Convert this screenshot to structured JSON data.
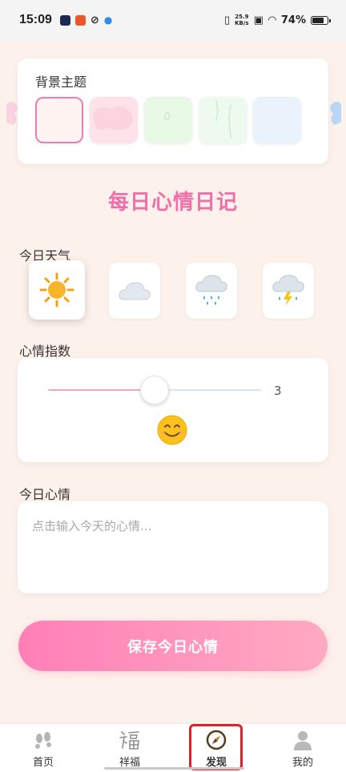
{
  "status_bar": {
    "time": "15:09",
    "net_speed_value": "25.9",
    "net_speed_unit": "KB/s",
    "battery": "74%"
  },
  "theme": {
    "title": "背景主题",
    "swatches": [
      {
        "name": "plain-peach",
        "color": "#fff4f1"
      },
      {
        "name": "pink-cloud",
        "color": "#fde3e9"
      },
      {
        "name": "green-leaf",
        "color": "#e8f9e6"
      },
      {
        "name": "mint-green",
        "color": "#eefaf0"
      },
      {
        "name": "light-blue",
        "color": "#eaf3fc"
      }
    ],
    "selected_index": 0
  },
  "heading": "每日心情日记",
  "weather": {
    "label": "今日天气",
    "options": [
      "sun-icon",
      "cloud-icon",
      "rain-icon",
      "thunderstorm-icon"
    ],
    "selected_index": 0
  },
  "mood": {
    "label": "心情指数",
    "value": "3",
    "min": 1,
    "max": 5,
    "emoji": "smiling-face-icon"
  },
  "diary": {
    "label": "今日心情",
    "placeholder": "点击输入今天的心情...",
    "value": ""
  },
  "save_button": "保存今日心情",
  "nav": {
    "items": [
      {
        "label": "首页",
        "icon": "footprints-icon"
      },
      {
        "label": "祥福",
        "icon": "fu-calligraphy-icon"
      },
      {
        "label": "发现",
        "icon": "compass-icon"
      },
      {
        "label": "我的",
        "icon": "person-icon"
      }
    ],
    "active_index": 2
  },
  "colors": {
    "accent_pink": "#f06fa9",
    "page_background": "#fdf1ec",
    "highlight_red": "#e0202a"
  }
}
